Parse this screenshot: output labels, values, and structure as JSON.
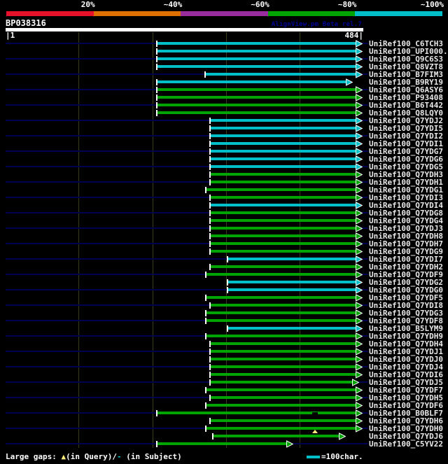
{
  "header": {
    "query_id": "BP038316",
    "watermark": "AlignView.pm Beta rel.7",
    "ruler": {
      "start_label": "|1",
      "end_label": "484|"
    }
  },
  "identity_scale": {
    "labels": [
      "20%",
      "~40%",
      "~60%",
      "~80%",
      "~100%"
    ],
    "colors": [
      "#e8112a",
      "#dd7000",
      "#9a2d9e",
      "#00a400",
      "#00bfc8"
    ]
  },
  "footer": {
    "large_gaps_prefix": "Large gaps: ",
    "query_gap_glyph": "▲",
    "query_gap_text": "(in Query)/",
    "subject_gap_glyph": "-",
    "subject_gap_text": " (in Subject)",
    "scale_note": "=100char."
  },
  "chart_data": {
    "type": "alignment-track",
    "title": "BP038316",
    "query_range": [
      1,
      484
    ],
    "x_gridlines": [
      100,
      200,
      300,
      400
    ],
    "identity_buckets": {
      "cyan": "~100%",
      "green": "~80%"
    },
    "bucket_colors": {
      "cyan": "#00bfc8",
      "green": "#00a400"
    },
    "hits": [
      {
        "label": "UniRef100_C6TCH3",
        "bucket": "cyan",
        "start": 206,
        "end": 484
      },
      {
        "label": "UniRef100_UPI000..",
        "bucket": "cyan",
        "start": 206,
        "end": 484
      },
      {
        "label": "UniRef100_Q9C6S3",
        "bucket": "cyan",
        "start": 206,
        "end": 484
      },
      {
        "label": "UniRef100_Q8VZT8",
        "bucket": "cyan",
        "start": 206,
        "end": 484
      },
      {
        "label": "UniRef100_B7FIM3",
        "bucket": "cyan",
        "start": 271,
        "end": 484
      },
      {
        "label": "UniRef100_B9RY19",
        "bucket": "cyan",
        "start": 206,
        "end": 471
      },
      {
        "label": "UniRef100_Q6ASY6",
        "bucket": "green",
        "start": 206,
        "end": 484
      },
      {
        "label": "UniRef100_P93408",
        "bucket": "green",
        "start": 206,
        "end": 484
      },
      {
        "label": "UniRef100_B6T442",
        "bucket": "green",
        "start": 206,
        "end": 484
      },
      {
        "label": "UniRef100_Q8LQY0",
        "bucket": "green",
        "start": 206,
        "end": 484
      },
      {
        "label": "UniRef100_Q7YDJ2",
        "bucket": "cyan",
        "start": 278,
        "end": 484
      },
      {
        "label": "UniRef100_Q7YDI5",
        "bucket": "cyan",
        "start": 278,
        "end": 484
      },
      {
        "label": "UniRef100_Q7YDI2",
        "bucket": "cyan",
        "start": 278,
        "end": 484
      },
      {
        "label": "UniRef100_Q7YDI1",
        "bucket": "cyan",
        "start": 278,
        "end": 484
      },
      {
        "label": "UniRef100_Q7YDG7",
        "bucket": "cyan",
        "start": 278,
        "end": 484
      },
      {
        "label": "UniRef100_Q7YDG6",
        "bucket": "cyan",
        "start": 278,
        "end": 484
      },
      {
        "label": "UniRef100_Q7YDG5",
        "bucket": "cyan",
        "start": 278,
        "end": 484
      },
      {
        "label": "UniRef100_Q7YDH3",
        "bucket": "green",
        "start": 278,
        "end": 484
      },
      {
        "label": "UniRef100_Q7YDH1",
        "bucket": "green",
        "start": 278,
        "end": 484
      },
      {
        "label": "UniRef100_Q7YDG1",
        "bucket": "green",
        "start": 272,
        "end": 484
      },
      {
        "label": "UniRef100_Q7YDI3",
        "bucket": "green",
        "start": 278,
        "end": 484
      },
      {
        "label": "UniRef100_Q7YDI4",
        "bucket": "cyan",
        "start": 278,
        "end": 484
      },
      {
        "label": "UniRef100_Q7YDG8",
        "bucket": "green",
        "start": 278,
        "end": 484
      },
      {
        "label": "UniRef100_Q7YDG4",
        "bucket": "green",
        "start": 278,
        "end": 484
      },
      {
        "label": "UniRef100_Q7YDJ3",
        "bucket": "green",
        "start": 278,
        "end": 484
      },
      {
        "label": "UniRef100_Q7YDH8",
        "bucket": "green",
        "start": 278,
        "end": 484
      },
      {
        "label": "UniRef100_Q7YDH7",
        "bucket": "green",
        "start": 278,
        "end": 484
      },
      {
        "label": "UniRef100_Q7YDG9",
        "bucket": "green",
        "start": 278,
        "end": 484
      },
      {
        "label": "UniRef100_Q7YDI7",
        "bucket": "cyan",
        "start": 302,
        "end": 484
      },
      {
        "label": "UniRef100_Q7YDH2",
        "bucket": "green",
        "start": 278,
        "end": 484
      },
      {
        "label": "UniRef100_Q7YDF9",
        "bucket": "green",
        "start": 272,
        "end": 484
      },
      {
        "label": "UniRef100_Q7YDG2",
        "bucket": "cyan",
        "start": 302,
        "end": 484
      },
      {
        "label": "UniRef100_Q7YDG0",
        "bucket": "cyan",
        "start": 302,
        "end": 484
      },
      {
        "label": "UniRef100_Q7YDF5",
        "bucket": "green",
        "start": 272,
        "end": 484
      },
      {
        "label": "UniRef100_Q7YDI8",
        "bucket": "green",
        "start": 278,
        "end": 484
      },
      {
        "label": "UniRef100_Q7YDG3",
        "bucket": "green",
        "start": 272,
        "end": 484
      },
      {
        "label": "UniRef100_Q7YDF8",
        "bucket": "green",
        "start": 272,
        "end": 484
      },
      {
        "label": "UniRef100_B5LYM9",
        "bucket": "cyan",
        "start": 302,
        "end": 484
      },
      {
        "label": "UniRef100_Q7YDH9",
        "bucket": "green",
        "start": 272,
        "end": 484
      },
      {
        "label": "UniRef100_Q7YDH4",
        "bucket": "green",
        "start": 278,
        "end": 484
      },
      {
        "label": "UniRef100_Q7YDJ1",
        "bucket": "green",
        "start": 278,
        "end": 484
      },
      {
        "label": "UniRef100_Q7YDJ0",
        "bucket": "green",
        "start": 278,
        "end": 484
      },
      {
        "label": "UniRef100_Q7YDJ4",
        "bucket": "green",
        "start": 278,
        "end": 484
      },
      {
        "label": "UniRef100_Q7YDI6",
        "bucket": "green",
        "start": 278,
        "end": 484
      },
      {
        "label": "UniRef100_Q7YDJ5",
        "bucket": "green",
        "start": 278,
        "end": 479
      },
      {
        "label": "UniRef100_Q7YDF7",
        "bucket": "green",
        "start": 272,
        "end": 484
      },
      {
        "label": "UniRef100_Q7YDH5",
        "bucket": "green",
        "start": 278,
        "end": 484
      },
      {
        "label": "UniRef100_Q7YDF6",
        "bucket": "green",
        "start": 272,
        "end": 484
      },
      {
        "label": "UniRef100_B0BLF7",
        "bucket": "green",
        "start": 206,
        "end": 484,
        "markers": [
          {
            "type": "subject_gap",
            "pos": 420
          }
        ]
      },
      {
        "label": "UniRef100_Q7YDH6",
        "bucket": "green",
        "start": 278,
        "end": 484
      },
      {
        "label": "UniRef100_Q7YDH0",
        "bucket": "green",
        "start": 272,
        "end": 484,
        "markers": [
          {
            "type": "query_gap",
            "pos": 420
          }
        ]
      },
      {
        "label": "UniRef100_Q7YDJ6",
        "bucket": "green",
        "start": 282,
        "end": 461
      },
      {
        "label": "UniRef100_C5YV22",
        "bucket": "green",
        "start": 206,
        "end": 390
      }
    ]
  }
}
